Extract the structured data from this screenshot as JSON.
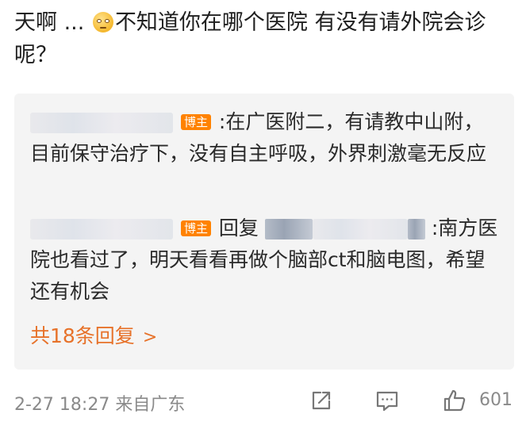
{
  "comment": {
    "text_before_emoji": "天啊 ...",
    "emoji": "eye-roll-emoji",
    "text_after_emoji": "不知道你在哪个医院 有没有请外院会诊呢？"
  },
  "replies": [
    {
      "username_hidden": true,
      "badge": "博主",
      "text": ":在广医附二，有请教中山附，目前保守治疗下，没有自主呼吸，外界刺激毫无反应"
    },
    {
      "username_hidden": true,
      "badge": "博主",
      "reply_label": "回复",
      "text": ":南方医院也看过了，明天看看再做个脑部ct和脑电图，希望还有机会"
    }
  ],
  "total_replies": {
    "label": "共18条回复",
    "chevron": ">"
  },
  "footer": {
    "timestamp": "2-27 18:27 来自广东",
    "like_count": "601",
    "icons": [
      "share-icon",
      "comment-icon",
      "like-icon"
    ]
  },
  "colors": {
    "badge": "#ff8200",
    "link": "#e7722a",
    "reply_bg": "#f4f4f4",
    "meta": "#8a8a8a"
  }
}
